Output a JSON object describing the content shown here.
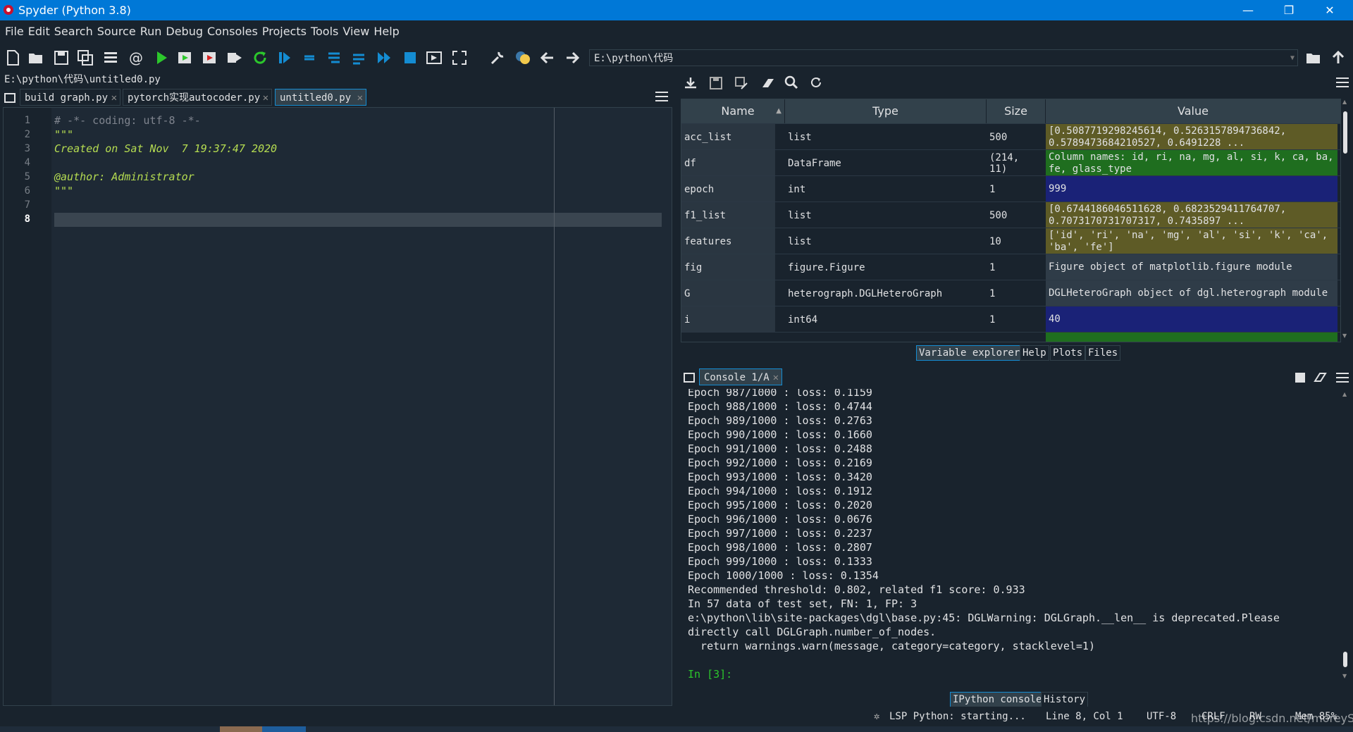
{
  "window": {
    "title": "Spyder (Python 3.8)",
    "controls": [
      "—",
      "❐",
      "✕"
    ]
  },
  "menu": [
    "File",
    "Edit",
    "Search",
    "Source",
    "Run",
    "Debug",
    "Consoles",
    "Projects",
    "Tools",
    "View",
    "Help"
  ],
  "toolbar": {
    "working_directory": "E:\\python\\代码"
  },
  "editor": {
    "file_path": "E:\\python\\代码\\untitled0.py",
    "tabs": [
      {
        "label": "build graph.py",
        "active": false
      },
      {
        "label": "pytorch实现autocoder.py",
        "active": false
      },
      {
        "label": "untitled0.py",
        "active": true
      }
    ],
    "line_numbers": [
      "1",
      "2",
      "3",
      "4",
      "5",
      "6",
      "7",
      "8"
    ],
    "current_line": "8",
    "lines": [
      "# -*- coding: utf-8 -*-",
      "\"\"\"",
      "Created on Sat Nov  7 19:37:47 2020",
      "",
      "@author: Administrator",
      "\"\"\"",
      "",
      ""
    ]
  },
  "variable_explorer": {
    "headers": {
      "name": "Name",
      "type": "Type",
      "size": "Size",
      "value": "Value"
    },
    "rows": [
      {
        "name": "acc_list",
        "type": "list",
        "size": "500",
        "value": "[0.5087719298245614, 0.5263157894736842, 0.5789473684210527, 0.6491228 ...",
        "color": "#5e5b26"
      },
      {
        "name": "df",
        "type": "DataFrame",
        "size": "(214, 11)",
        "value": "Column names: id, ri, na, mg, al, si, k, ca, ba, fe, glass_type",
        "color": "#1f6e1f"
      },
      {
        "name": "epoch",
        "type": "int",
        "size": "1",
        "value": "999",
        "color": "#1a2277"
      },
      {
        "name": "f1_list",
        "type": "list",
        "size": "500",
        "value": "[0.6744186046511628, 0.6823529411764707, 0.7073170731707317, 0.7435897 ...",
        "color": "#5e5b26"
      },
      {
        "name": "features",
        "type": "list",
        "size": "10",
        "value": "['id', 'ri', 'na', 'mg', 'al', 'si', 'k', 'ca', 'ba', 'fe']",
        "color": "#5e5b26"
      },
      {
        "name": "fig",
        "type": "figure.Figure",
        "size": "1",
        "value": "Figure object of matplotlib.figure module",
        "color": "#2f3c48"
      },
      {
        "name": "G",
        "type": "heterograph.DGLHeteroGraph",
        "size": "1",
        "value": "DGLHeteroGraph object of dgl.heterograph module",
        "color": "#2f3c48"
      },
      {
        "name": "i",
        "type": "int64",
        "size": "1",
        "value": "40",
        "color": "#1a2277"
      }
    ],
    "pane_tabs": [
      "Variable explorer",
      "Help",
      "Plots",
      "Files"
    ]
  },
  "console": {
    "tab": "Console 1/A",
    "lines": [
      "Epoch 987/1000 : loss: 0.1159",
      "Epoch 988/1000 : loss: 0.4744",
      "Epoch 989/1000 : loss: 0.2763",
      "Epoch 990/1000 : loss: 0.1660",
      "Epoch 991/1000 : loss: 0.2488",
      "Epoch 992/1000 : loss: 0.2169",
      "Epoch 993/1000 : loss: 0.3420",
      "Epoch 994/1000 : loss: 0.1912",
      "Epoch 995/1000 : loss: 0.2020",
      "Epoch 996/1000 : loss: 0.0676",
      "Epoch 997/1000 : loss: 0.2237",
      "Epoch 998/1000 : loss: 0.2807",
      "Epoch 999/1000 : loss: 0.1333",
      "Epoch 1000/1000 : loss: 0.1354",
      "Recommended threshold: 0.802, related f1 score: 0.933",
      "In 57 data of test set, FN: 1, FP: 3",
      "e:\\python\\lib\\site-packages\\dgl\\base.py:45: DGLWarning: DGLGraph.__len__ is deprecated.Please",
      "directly call DGLGraph.number_of_nodes.",
      "  return warnings.warn(message, category=category, stacklevel=1)"
    ],
    "prompt": "In [3]:",
    "pane_tabs": [
      "IPython console",
      "History"
    ]
  },
  "statusbar": {
    "lsp": "LSP Python: starting...",
    "position": "Line 8, Col 1",
    "encoding": "UTF-8",
    "eol": "CRLF",
    "rw": "RW",
    "mem": "Mem 85%"
  },
  "watermark": "https://blog.csdn.net/moreySCI",
  "colors": {
    "accent": "#148cd2",
    "titlebar": "#0078d7",
    "background": "#19232d",
    "docstring": "#b5dc51"
  }
}
